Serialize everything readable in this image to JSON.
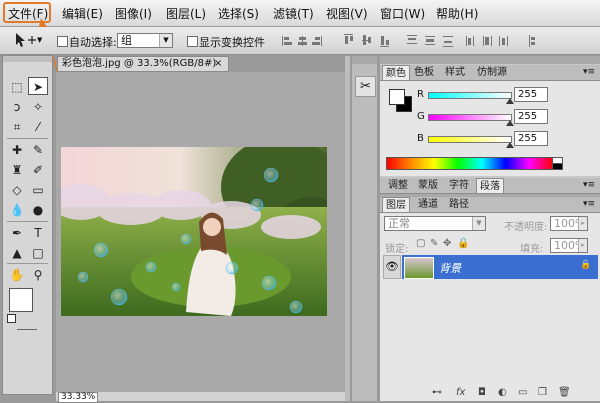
{
  "menubar": {
    "items": [
      "文件(F)",
      "编辑(E)",
      "图像(I)",
      "图层(L)",
      "选择(S)",
      "滤镜(T)",
      "视图(V)",
      "窗口(W)",
      "帮助(H)"
    ]
  },
  "options": {
    "auto_select_label": "自动选择:",
    "auto_select_value": "组",
    "show_transform_label": "显示变换控件"
  },
  "document": {
    "tab_title": "彩色泡泡.jpg @ 33.3%(RGB/8#)",
    "close": "×",
    "zoom": "33.33%"
  },
  "color_panel": {
    "tabs": [
      "颜色",
      "色板",
      "样式",
      "仿制源"
    ],
    "channels": [
      {
        "label": "R",
        "value": "255"
      },
      {
        "label": "G",
        "value": "255"
      },
      {
        "label": "B",
        "value": "255"
      }
    ]
  },
  "adjust_panel": {
    "tabs": [
      "调整",
      "蒙版",
      "字符",
      "段落"
    ]
  },
  "layers_panel": {
    "tabs": [
      "图层",
      "通道",
      "路径"
    ],
    "blend_mode": "正常",
    "opacity_label": "不透明度:",
    "opacity_value": "100%",
    "lock_label": "锁定:",
    "fill_label": "填充:",
    "fill_value": "100%",
    "layer_name": "背景"
  },
  "colors": {
    "accent": "#e07a2c",
    "layer_selected": "#3a6fd1"
  }
}
